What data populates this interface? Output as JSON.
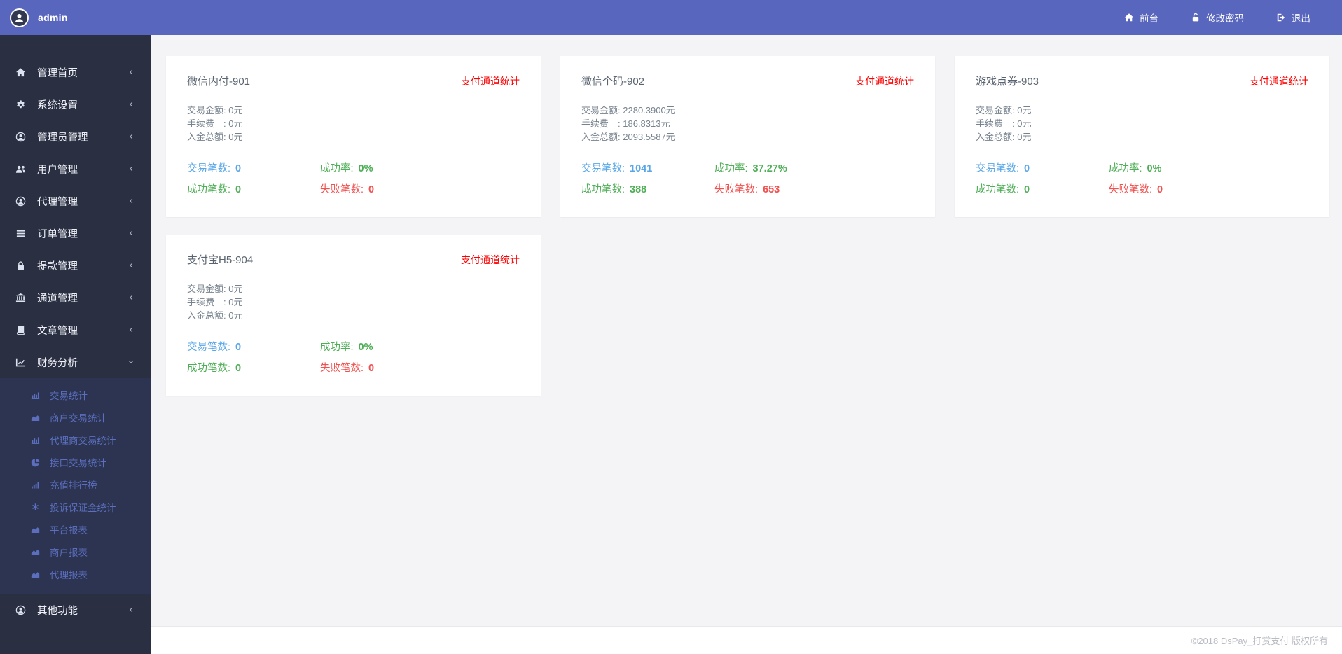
{
  "topbar": {
    "username": "admin",
    "nav": [
      {
        "label": "前台",
        "icon": "home-icon"
      },
      {
        "label": "修改密码",
        "icon": "unlock-icon"
      },
      {
        "label": "退出",
        "icon": "sign-out-icon"
      }
    ]
  },
  "sidebar": {
    "items": [
      {
        "label": "管理首页",
        "icon": "home-icon"
      },
      {
        "label": "系统设置",
        "icon": "cogs-icon"
      },
      {
        "label": "管理员管理",
        "icon": "user-circle-icon"
      },
      {
        "label": "用户管理",
        "icon": "users-icon"
      },
      {
        "label": "代理管理",
        "icon": "user-circle-icon"
      },
      {
        "label": "订单管理",
        "icon": "list-icon"
      },
      {
        "label": "提款管理",
        "icon": "lock-icon"
      },
      {
        "label": "通道管理",
        "icon": "bank-icon"
      },
      {
        "label": "文章管理",
        "icon": "book-icon"
      },
      {
        "label": "财务分析",
        "icon": "chart-line-icon",
        "expanded": true
      },
      {
        "label": "其他功能",
        "icon": "user-circle-icon"
      }
    ],
    "submenu": [
      {
        "label": "交易统计",
        "icon": "bar-chart-icon"
      },
      {
        "label": "商户交易统计",
        "icon": "area-chart-icon"
      },
      {
        "label": "代理商交易统计",
        "icon": "bar-chart-icon"
      },
      {
        "label": "接口交易统计",
        "icon": "pie-chart-icon"
      },
      {
        "label": "充值排行榜",
        "icon": "signal-icon"
      },
      {
        "label": "投诉保证金统计",
        "icon": "asterisk-icon"
      },
      {
        "label": "平台报表",
        "icon": "area-chart-icon"
      },
      {
        "label": "商户报表",
        "icon": "area-chart-icon"
      },
      {
        "label": "代理报表",
        "icon": "area-chart-icon"
      }
    ]
  },
  "cards": [
    {
      "title": "微信内付-901",
      "link": "支付通道统计",
      "amounts": [
        {
          "label": "交易金额:",
          "value": "0元"
        },
        {
          "label": "手续费　:",
          "value": "0元"
        },
        {
          "label": "入金总额:",
          "value": "0元"
        }
      ],
      "stats": [
        {
          "label": "交易笔数:",
          "value": "0",
          "color": "blue"
        },
        {
          "label": "成功率:",
          "value": "0%",
          "color": "green"
        },
        {
          "label": "成功笔数:",
          "value": "0",
          "color": "green"
        },
        {
          "label": "失败笔数:",
          "value": "0",
          "color": "red"
        }
      ]
    },
    {
      "title": "微信个码-902",
      "link": "支付通道统计",
      "amounts": [
        {
          "label": "交易金额:",
          "value": "2280.3900元"
        },
        {
          "label": "手续费　:",
          "value": "186.8313元"
        },
        {
          "label": "入金总额:",
          "value": "2093.5587元"
        }
      ],
      "stats": [
        {
          "label": "交易笔数:",
          "value": "1041",
          "color": "blue"
        },
        {
          "label": "成功率:",
          "value": "37.27%",
          "color": "green"
        },
        {
          "label": "成功笔数:",
          "value": "388",
          "color": "green"
        },
        {
          "label": "失败笔数:",
          "value": "653",
          "color": "red"
        }
      ]
    },
    {
      "title": "游戏点券-903",
      "link": "支付通道统计",
      "amounts": [
        {
          "label": "交易金额:",
          "value": "0元"
        },
        {
          "label": "手续费　:",
          "value": "0元"
        },
        {
          "label": "入金总额:",
          "value": "0元"
        }
      ],
      "stats": [
        {
          "label": "交易笔数:",
          "value": "0",
          "color": "blue"
        },
        {
          "label": "成功率:",
          "value": "0%",
          "color": "green"
        },
        {
          "label": "成功笔数:",
          "value": "0",
          "color": "green"
        },
        {
          "label": "失败笔数:",
          "value": "0",
          "color": "red"
        }
      ]
    },
    {
      "title": "支付宝H5-904",
      "link": "支付通道统计",
      "amounts": [
        {
          "label": "交易金额:",
          "value": "0元"
        },
        {
          "label": "手续费　:",
          "value": "0元"
        },
        {
          "label": "入金总额:",
          "value": "0元"
        }
      ],
      "stats": [
        {
          "label": "交易笔数:",
          "value": "0",
          "color": "blue"
        },
        {
          "label": "成功率:",
          "value": "0%",
          "color": "green"
        },
        {
          "label": "成功笔数:",
          "value": "0",
          "color": "green"
        },
        {
          "label": "失败笔数:",
          "value": "0",
          "color": "red"
        }
      ]
    }
  ],
  "footer": {
    "copyright": "©2018 DsPay_打赏支付 版权所有"
  },
  "colors": {
    "topbar": "#5966be",
    "sidebar": "#2a2f42",
    "submenu_bg": "#2c3452",
    "submenu_text": "#5b6fbe",
    "accent_red": "#fb0000",
    "stat_blue": "#58a6e8",
    "stat_green": "#4fae57",
    "stat_red": "#f0504e"
  }
}
